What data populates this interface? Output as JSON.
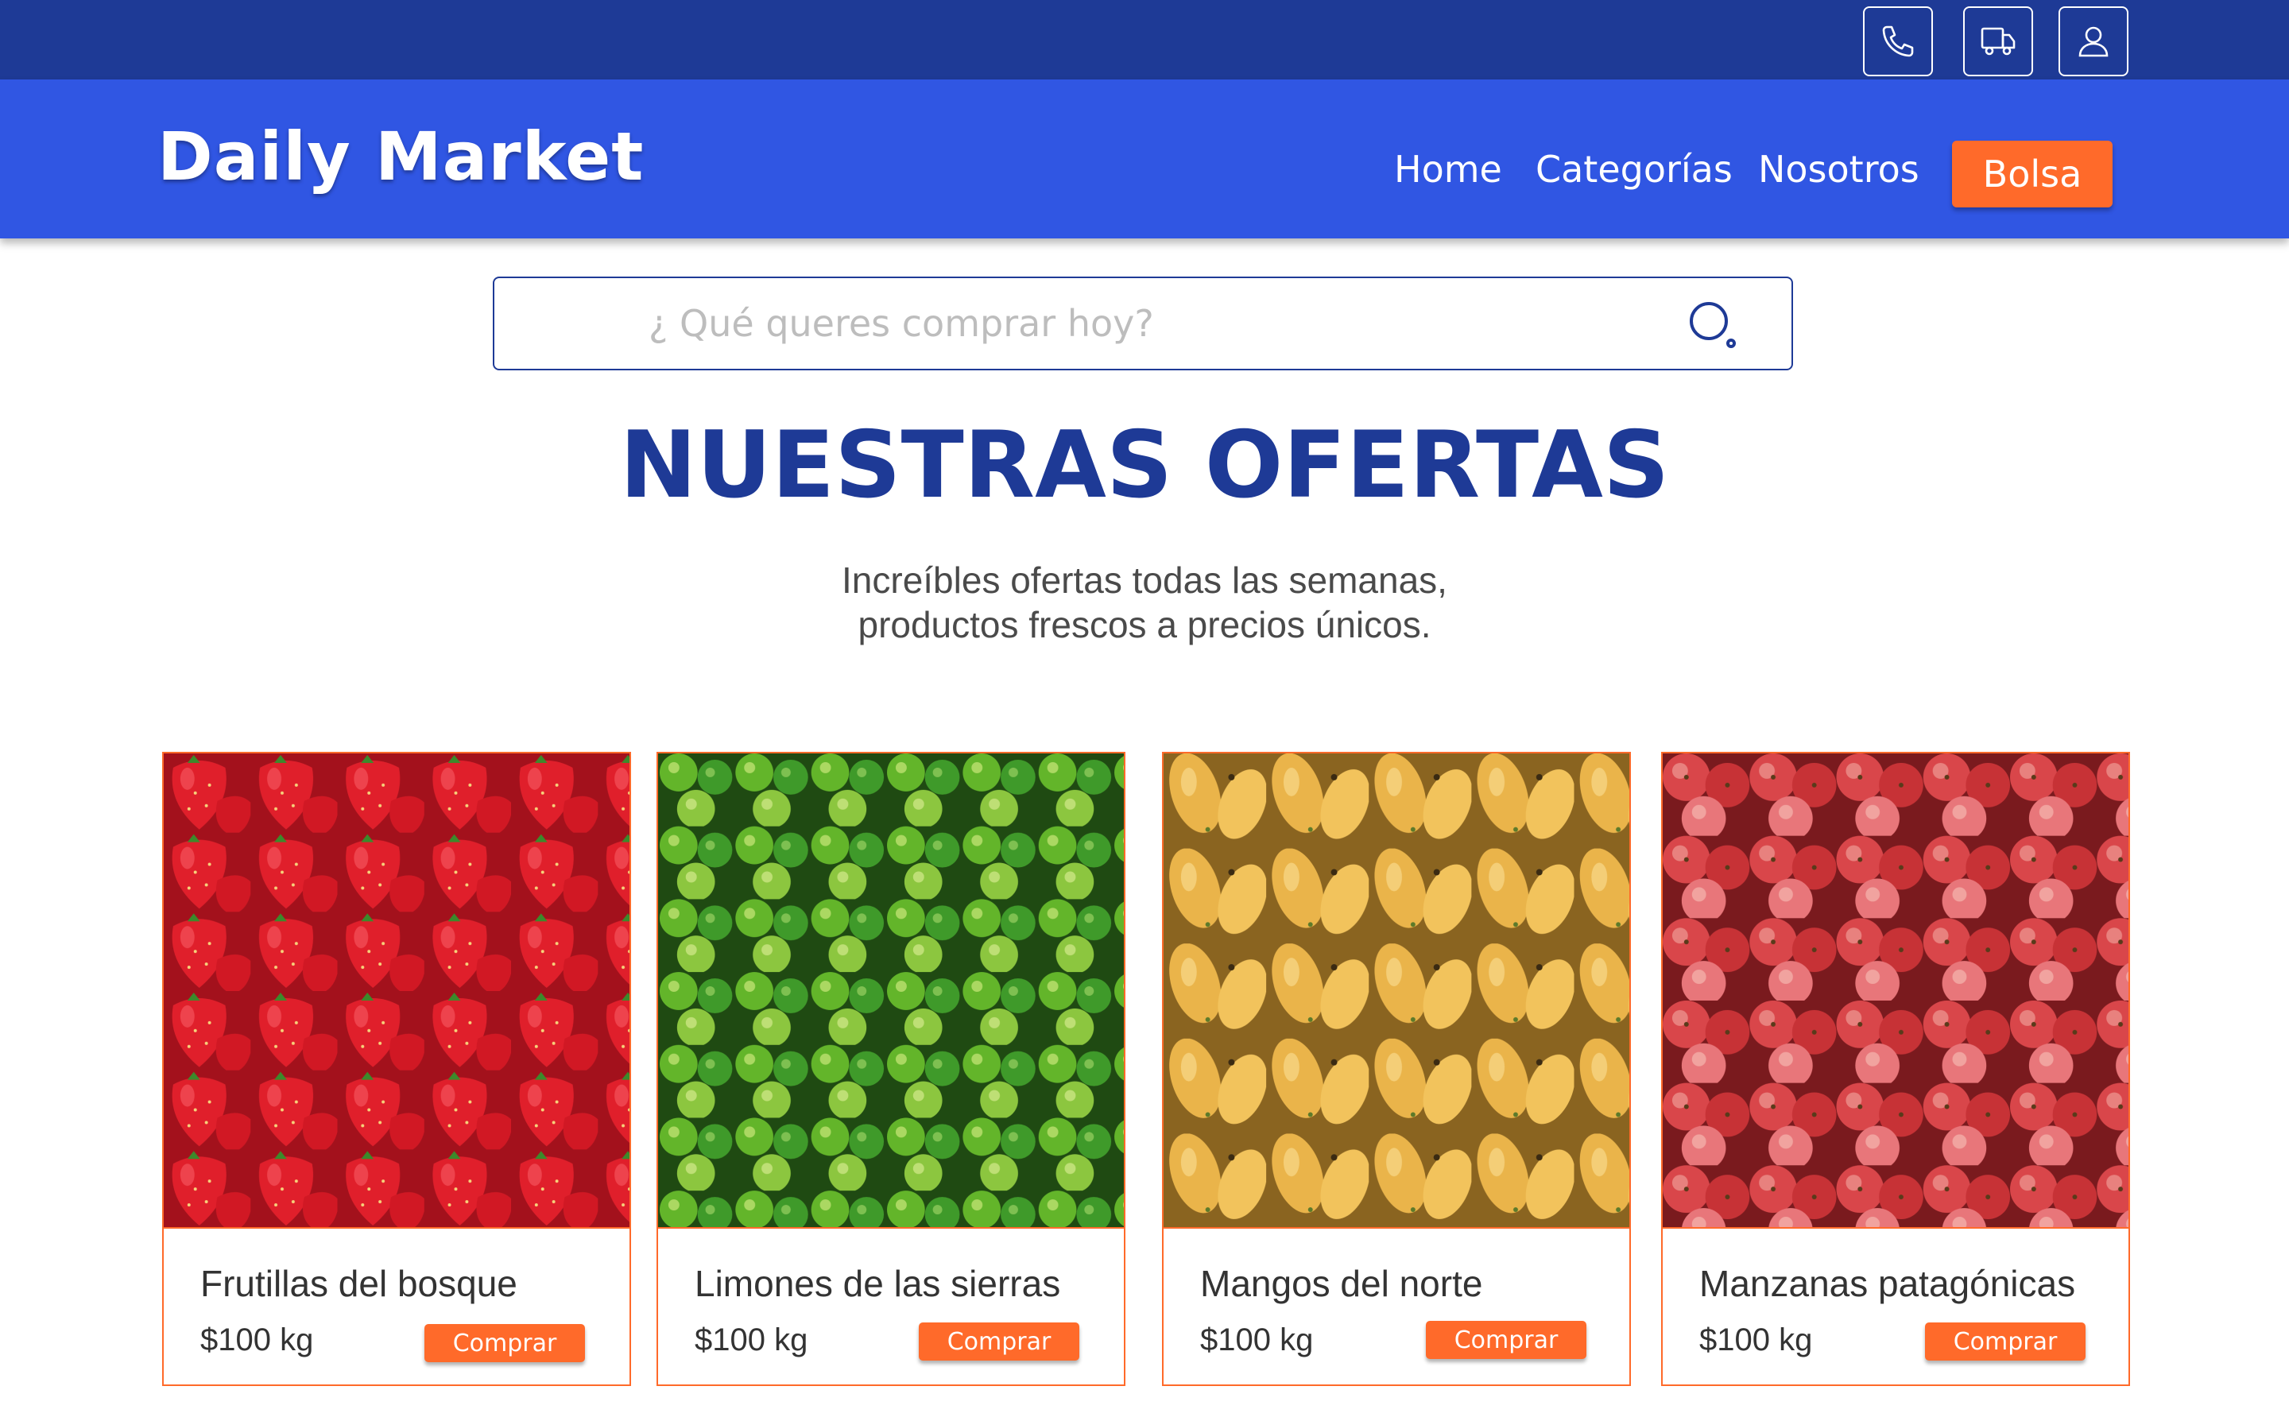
{
  "topbar": {
    "icons": [
      {
        "name": "phone-icon"
      },
      {
        "name": "truck-icon"
      },
      {
        "name": "user-icon"
      }
    ]
  },
  "header": {
    "logo": "Daily Market",
    "nav": [
      "Home",
      "Categorías",
      "Nosotros"
    ],
    "bag_label": "Bolsa"
  },
  "search": {
    "placeholder": "¿ Qué queres comprar hoy?",
    "value": ""
  },
  "offers": {
    "title": "NUESTRAS OFERTAS",
    "subtitle_line1": "Increíbles ofertas todas las semanas,",
    "subtitle_line2": "productos frescos a precios únicos."
  },
  "products": [
    {
      "name": "Frutillas del bosque",
      "price": "$100 kg",
      "button": "Comprar"
    },
    {
      "name": "Limones de las sierras",
      "price": "$100 kg",
      "button": "Comprar"
    },
    {
      "name": "Mangos del norte",
      "price": "$100 kg",
      "button": "Comprar"
    },
    {
      "name": "Manzanas patagónicas",
      "price": "$100 kg",
      "button": "Comprar"
    }
  ],
  "colors": {
    "topbar": "#1e3a96",
    "header": "#3056e3",
    "accent": "#ff6a2a",
    "title": "#1e3a96"
  }
}
